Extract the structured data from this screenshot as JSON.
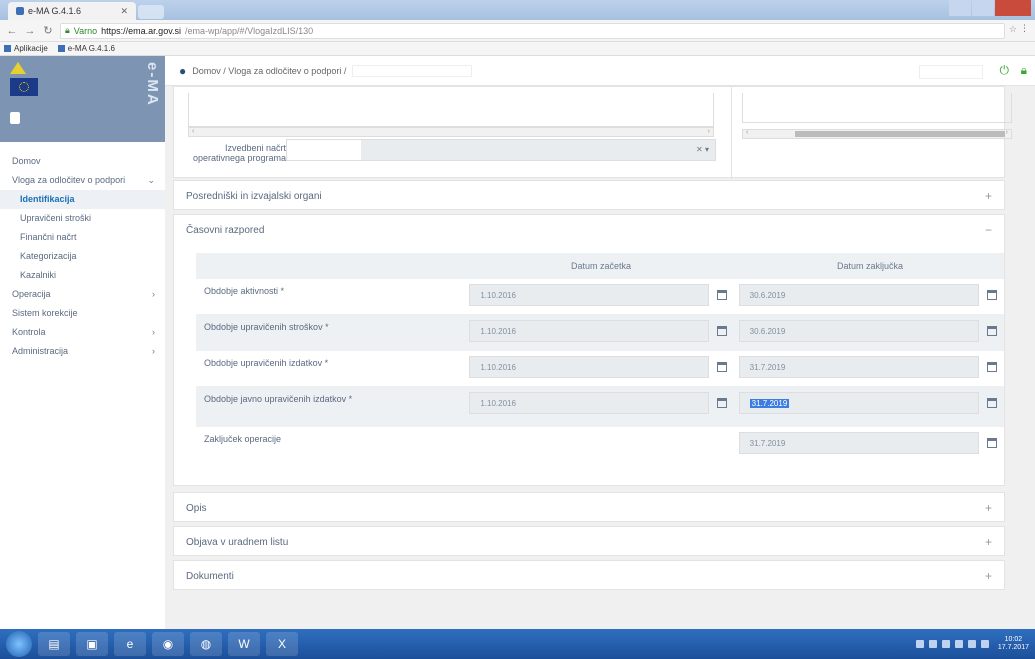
{
  "browser": {
    "tab_title": "e-MA G.4.1.6",
    "tab_close": "✕",
    "address_secure": "Varno",
    "address_host": "https://ema.ar.gov.si",
    "address_path": "/ema-wp/app/#/VlogaIzdLIS/130",
    "bookmarks": [
      "Aplikacije",
      "e-MA G.4.1.6"
    ]
  },
  "sidebar": {
    "logo_text": "e-MA",
    "items": [
      {
        "label": "Domov",
        "arrow": ""
      },
      {
        "label": "Vloga za odločitev o podpori",
        "arrow": "⌄"
      },
      {
        "label": "Identifikacija",
        "arrow": ""
      },
      {
        "label": "Upravičeni stroški",
        "arrow": ""
      },
      {
        "label": "Finančni načrt",
        "arrow": ""
      },
      {
        "label": "Kategorizacija",
        "arrow": ""
      },
      {
        "label": "Kazalniki",
        "arrow": ""
      },
      {
        "label": "Operacija",
        "arrow": "›"
      },
      {
        "label": "Sistem korekcije",
        "arrow": ""
      },
      {
        "label": "Kontrola",
        "arrow": "›"
      },
      {
        "label": "Administracija",
        "arrow": "›"
      }
    ]
  },
  "topbar": {
    "breadcrumb": "Domov  /  Vloga za odločitev o podpori  /"
  },
  "top_card": {
    "field_label": "Izvedbeni načrt operativnega programa",
    "select_controls": "✕ ▾"
  },
  "panels": {
    "posredniki": "Posredniški in izvajalski organi",
    "casovni": "Časovni razpored",
    "opis": "Opis",
    "objava": "Objava v uradnem listu",
    "dokumenti": "Dokumenti",
    "toggle_plus": "+",
    "toggle_minus": "−"
  },
  "schedule": {
    "col_start": "Datum začetka",
    "col_end": "Datum zaključka",
    "rows": [
      {
        "label": "Obdobje aktivnosti *",
        "start": "1.10.2016",
        "end": "30.6.2019"
      },
      {
        "label": "Obdobje upravičenih stroškov *",
        "start": "1.10.2016",
        "end": "30.6.2019"
      },
      {
        "label": "Obdobje upravičenih izdatkov *",
        "start": "1.10.2016",
        "end": "31.7.2019"
      },
      {
        "label": "Obdobje javno upravičenih izdatkov *",
        "start": "1.10.2016",
        "end": "31.7.2019"
      }
    ],
    "closing": {
      "label": "Zaključek operacije",
      "end": "31.7.2019"
    }
  },
  "taskbar": {
    "clock_time": "10:02",
    "clock_date": "17.7.2017"
  },
  "colors": {
    "accent_blue": "#1a6fb8",
    "green_icon": "#3aaa35",
    "sidebar_logo_bg": "#7d95b2",
    "taskbar": "#1c4f9a"
  }
}
